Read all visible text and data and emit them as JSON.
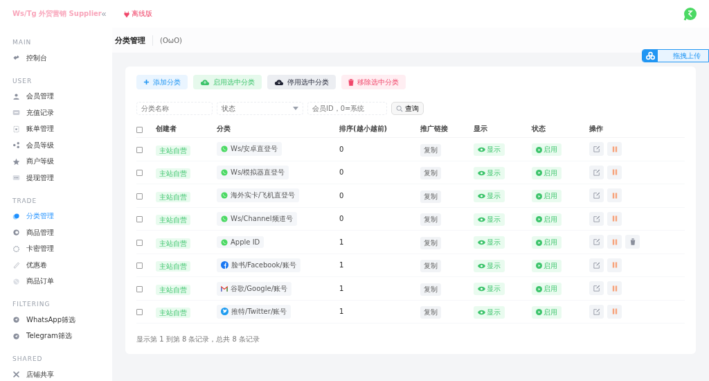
{
  "brand": {
    "title": "Ws/Tg 外贸营销 Supplier",
    "collapse": "«"
  },
  "topbar": {
    "badge": "离线版"
  },
  "page": {
    "title": "分类管理",
    "subtitle": "(OωO)"
  },
  "upload": {
    "label": "拖拽上传"
  },
  "sidebar": [
    {
      "heading": "MAIN",
      "items": [
        {
          "label": "控制台",
          "kind": "dashboard",
          "selected": false
        }
      ]
    },
    {
      "heading": "USER",
      "items": [
        {
          "label": "会员管理",
          "kind": "user",
          "selected": false
        },
        {
          "label": "充值记录",
          "kind": "card",
          "selected": false
        },
        {
          "label": "账单管理",
          "kind": "bill",
          "selected": false
        },
        {
          "label": "会员等级",
          "kind": "share",
          "selected": false
        },
        {
          "label": "商户等级",
          "kind": "star",
          "selected": false
        },
        {
          "label": "提现管理",
          "kind": "wallet",
          "selected": false
        }
      ]
    },
    {
      "heading": "TRADE",
      "items": [
        {
          "label": "分类管理",
          "kind": "category",
          "selected": true
        },
        {
          "label": "商品管理",
          "kind": "product",
          "selected": false
        },
        {
          "label": "卡密管理",
          "kind": "gear",
          "selected": false
        },
        {
          "label": "优惠卷",
          "kind": "coupon",
          "selected": false
        },
        {
          "label": "商品订单",
          "kind": "order",
          "selected": false
        }
      ]
    },
    {
      "heading": "FILTERING",
      "items": [
        {
          "label": "WhatsApp筛选",
          "kind": "send",
          "selected": false
        },
        {
          "label": "Telegram筛选",
          "kind": "send",
          "selected": false
        }
      ]
    },
    {
      "heading": "SHARED",
      "items": [
        {
          "label": "店铺共享",
          "kind": "tools",
          "selected": false
        }
      ]
    }
  ],
  "toolbar": [
    {
      "label": "添加分类",
      "kind": "add"
    },
    {
      "label": "启用选中分类",
      "kind": "enable"
    },
    {
      "label": "停用选中分类",
      "kind": "disable"
    },
    {
      "label": "移除选中分类",
      "kind": "remove"
    }
  ],
  "filters": {
    "name_placeholder": "分类名称",
    "status_placeholder": "状态",
    "member_placeholder": "会员ID，0=系统",
    "search": "查询"
  },
  "table": {
    "select_all_checked": false,
    "columns": [
      "创建者",
      "分类",
      "排序(越小越前)",
      "推广链接",
      "显示",
      "状态",
      "操作"
    ],
    "rows": [
      {
        "checked": false,
        "creator": "主站自营",
        "category": "Ws/安卓直登号",
        "kind": "whatsapp",
        "sort": "0",
        "link": "复制",
        "display": "显示",
        "status": "启用",
        "deletable": false
      },
      {
        "checked": false,
        "creator": "主站自营",
        "category": "Ws/模拟器直登号",
        "kind": "whatsapp",
        "sort": "0",
        "link": "复制",
        "display": "显示",
        "status": "启用",
        "deletable": false
      },
      {
        "checked": false,
        "creator": "主站自营",
        "category": "海外实卡/飞机直登号",
        "kind": "whatsapp",
        "sort": "0",
        "link": "复制",
        "display": "显示",
        "status": "启用",
        "deletable": false
      },
      {
        "checked": false,
        "creator": "主站自营",
        "category": "Ws/Channel频道号",
        "kind": "whatsapp",
        "sort": "0",
        "link": "复制",
        "display": "显示",
        "status": "启用",
        "deletable": false
      },
      {
        "checked": false,
        "creator": "主站自营",
        "category": "Apple ID",
        "kind": "whatsapp",
        "sort": "1",
        "link": "复制",
        "display": "显示",
        "status": "启用",
        "deletable": true
      },
      {
        "checked": false,
        "creator": "主站自营",
        "category": "脸书/Facebook/账号",
        "kind": "facebook",
        "sort": "1",
        "link": "复制",
        "display": "显示",
        "status": "启用",
        "deletable": false
      },
      {
        "checked": false,
        "creator": "主站自营",
        "category": "谷歌/Google/账号",
        "kind": "google",
        "sort": "1",
        "link": "复制",
        "display": "显示",
        "status": "启用",
        "deletable": false
      },
      {
        "checked": false,
        "creator": "主站自营",
        "category": "推特/Twitter/账号",
        "kind": "twitter",
        "sort": "1",
        "link": "复制",
        "display": "显示",
        "status": "启用",
        "deletable": false
      }
    ]
  },
  "footer": "显示第 1 到第 8 条记录，总共 8 条记录"
}
